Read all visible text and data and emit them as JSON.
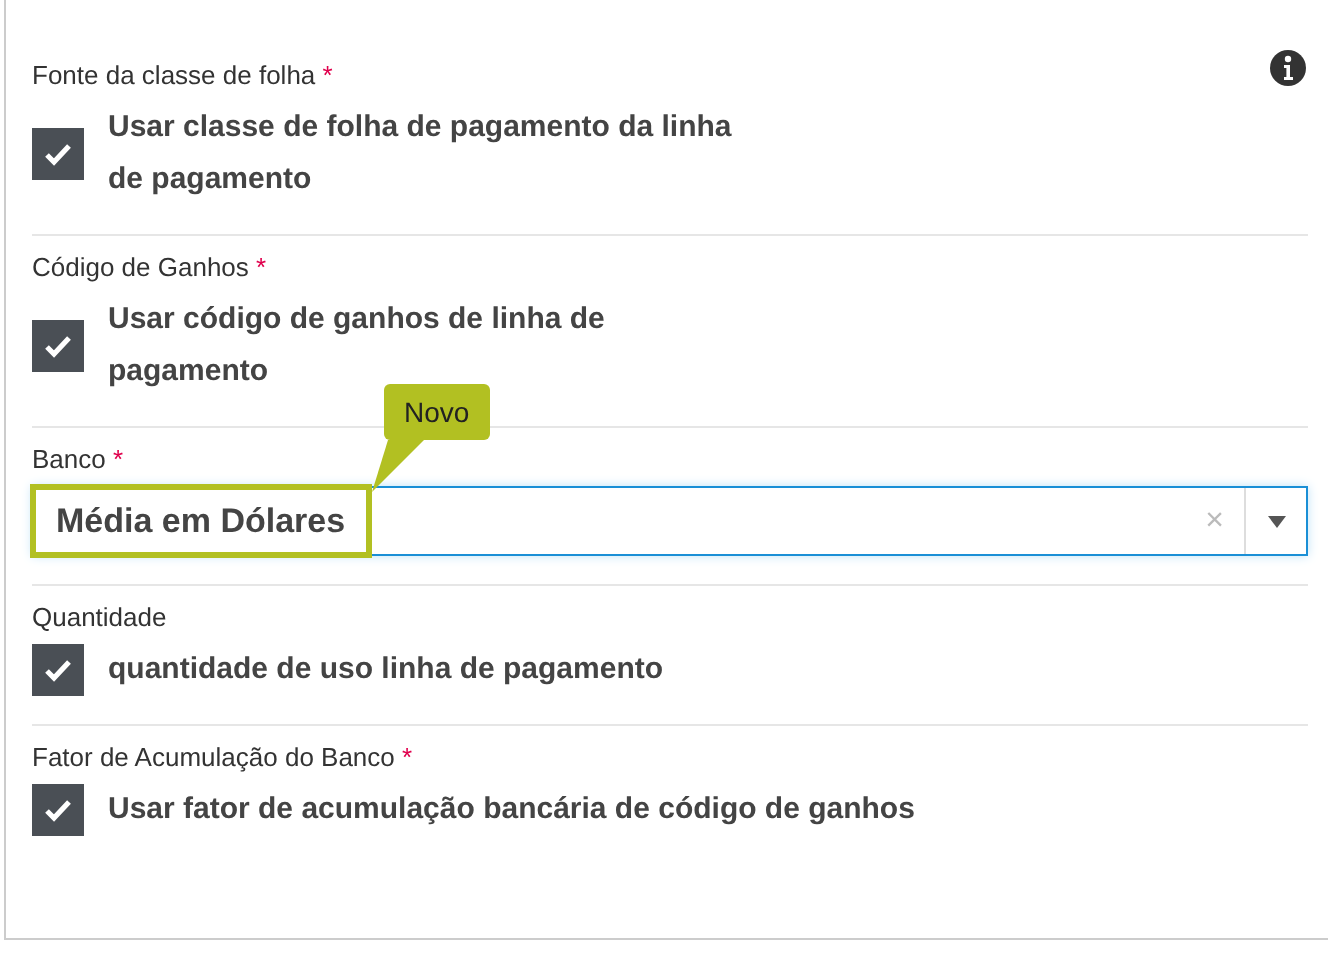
{
  "fields": [
    {
      "kind": "checkbox",
      "label": "Fonte da classe de folha",
      "marker": "*",
      "checked": true,
      "text": "Usar classe de folha de pagamento da linha de pagamento"
    },
    {
      "kind": "checkbox",
      "label": "Código de Ganhos",
      "marker": "*",
      "checked": true,
      "text": "Usar código de ganhos de linha de pagamento"
    },
    {
      "kind": "select",
      "label": "Banco",
      "marker": "*",
      "value": "Média em Dólares",
      "clear": "×",
      "callout": "Novo"
    },
    {
      "kind": "checkbox",
      "label": "Quantidade",
      "checked": true,
      "text": "quantidade de uso linha de pagamento"
    },
    {
      "kind": "checkbox",
      "label": "Fator de Acumulação do Banco",
      "marker": "*",
      "checked": true,
      "text": "Usar fator de acumulação bancária de código de ganhos"
    }
  ]
}
